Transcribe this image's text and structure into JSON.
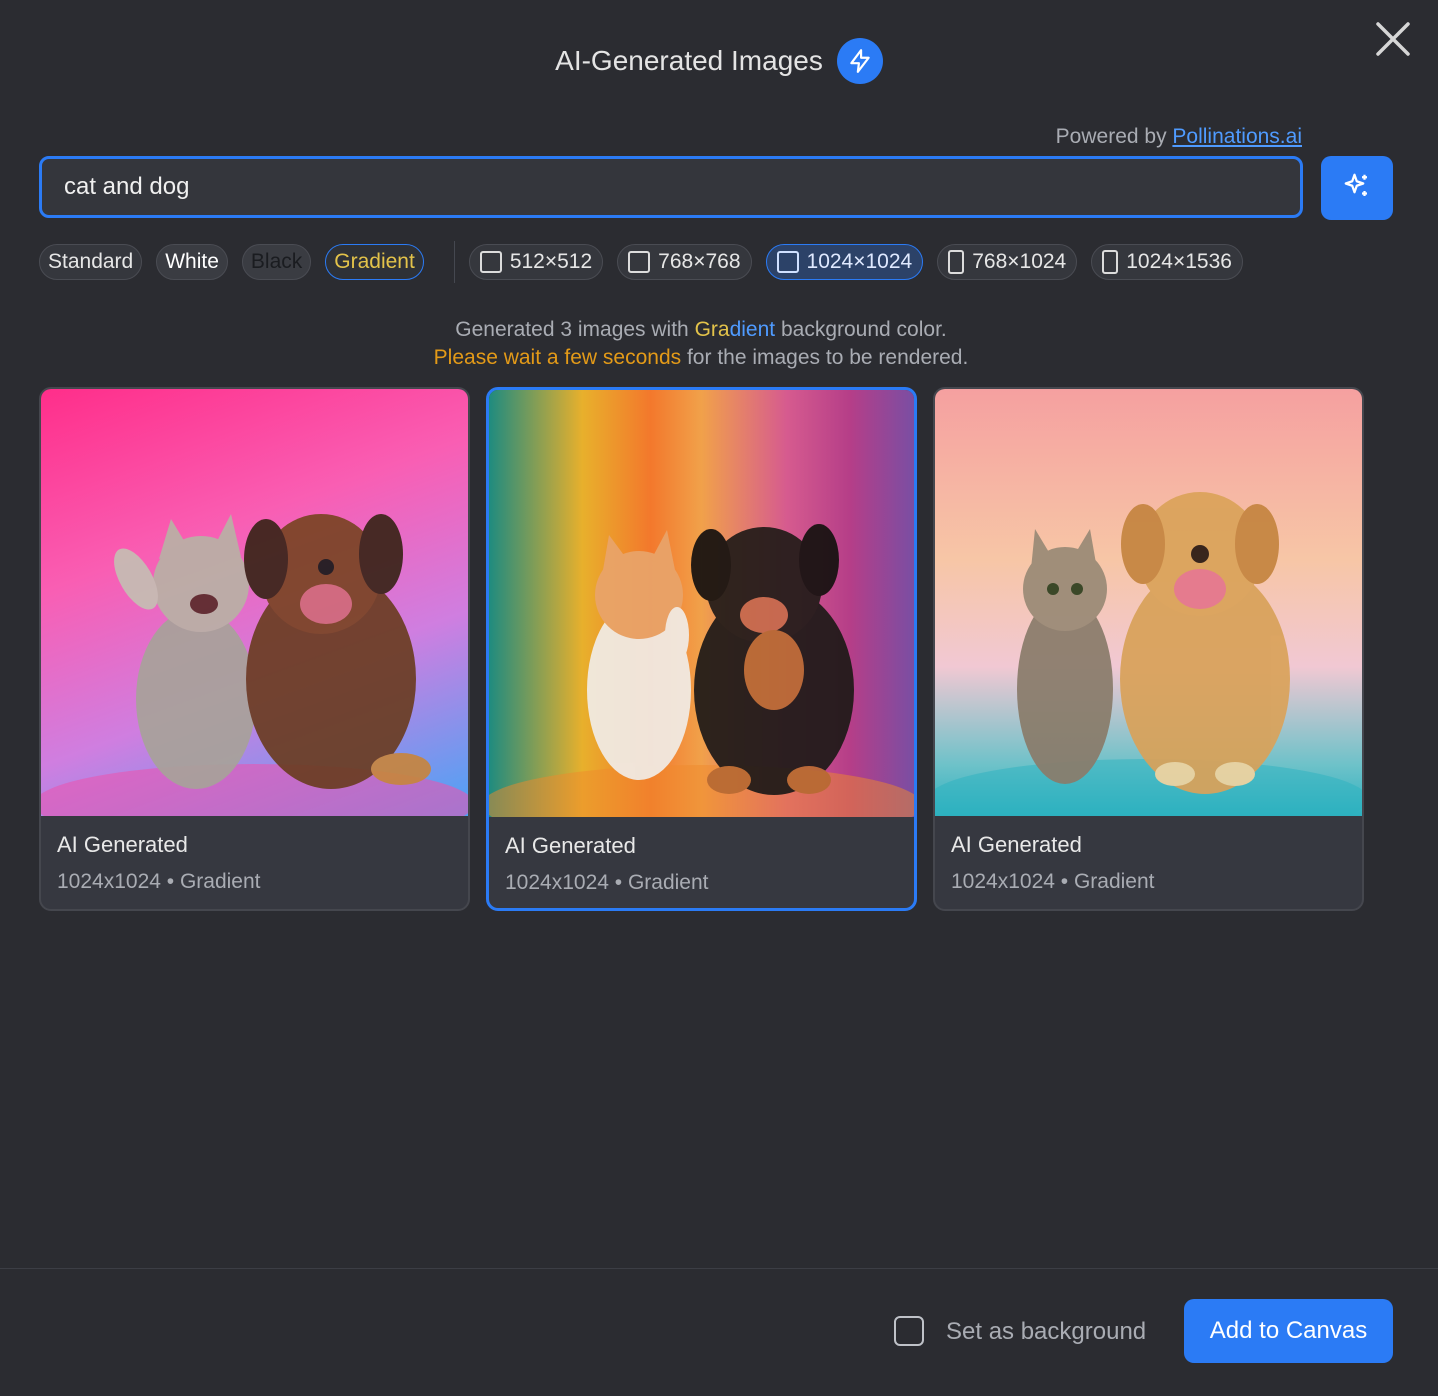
{
  "header": {
    "title": "AI-Generated Images",
    "badge_icon": "lightning-icon",
    "close_icon": "close-icon"
  },
  "powered": {
    "prefix": "Powered by ",
    "link": "Pollinations.ai"
  },
  "prompt": {
    "value": "cat and dog",
    "placeholder": ""
  },
  "generate_icon": "sparkle-icon",
  "backgrounds": {
    "standard": "Standard",
    "white": "White",
    "black": "Black",
    "gradient": "Gradient",
    "selected": "Gradient"
  },
  "sizes": [
    {
      "label": "512×512",
      "shape": "square",
      "active": false
    },
    {
      "label": "768×768",
      "shape": "square",
      "active": false
    },
    {
      "label": "1024×1024",
      "shape": "square",
      "active": true
    },
    {
      "label": "768×1024",
      "shape": "portrait",
      "active": false
    },
    {
      "label": "1024×1536",
      "shape": "portrait",
      "active": false
    }
  ],
  "status": {
    "line1_prefix": "Generated 3 images with ",
    "line1_gra": "Gra",
    "line1_dient": "dient",
    "line1_suffix": " background color.",
    "line2_highlight": "Please wait a few seconds",
    "line2_suffix": " for the images to be rendered."
  },
  "cards": [
    {
      "title": "AI Generated",
      "info": "1024x1024 • Gradient",
      "selected": false
    },
    {
      "title": "AI Generated",
      "info": "1024x1024 • Gradient",
      "selected": true
    },
    {
      "title": "AI Generated",
      "info": "1024x1024 • Gradient",
      "selected": false
    }
  ],
  "footer": {
    "checkbox_label": "Set as background",
    "checkbox_checked": false,
    "add_button": "Add to Canvas"
  },
  "colors": {
    "accent": "#2b7bf5",
    "background": "#2b2c31",
    "gradient_text": "#e3c34a",
    "wait_text": "#e39a18"
  }
}
